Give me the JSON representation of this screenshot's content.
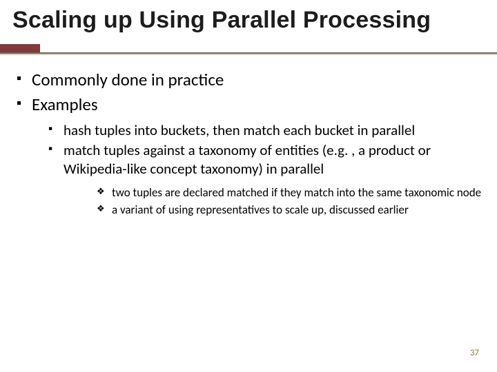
{
  "title": "Scaling up Using Parallel Processing",
  "bullets": {
    "l1": [
      "Commonly done in practice",
      "Examples"
    ],
    "l2": [
      "hash tuples into buckets, then match each bucket in parallel",
      "match tuples against a taxonomy of entities (e.g. , a product or Wikipedia-like concept taxonomy) in parallel"
    ],
    "l3": [
      "two tuples are declared matched if they match  into the same taxonomic node",
      "a variant of using representatives to scale up, discussed earlier"
    ]
  },
  "page_number": "37"
}
